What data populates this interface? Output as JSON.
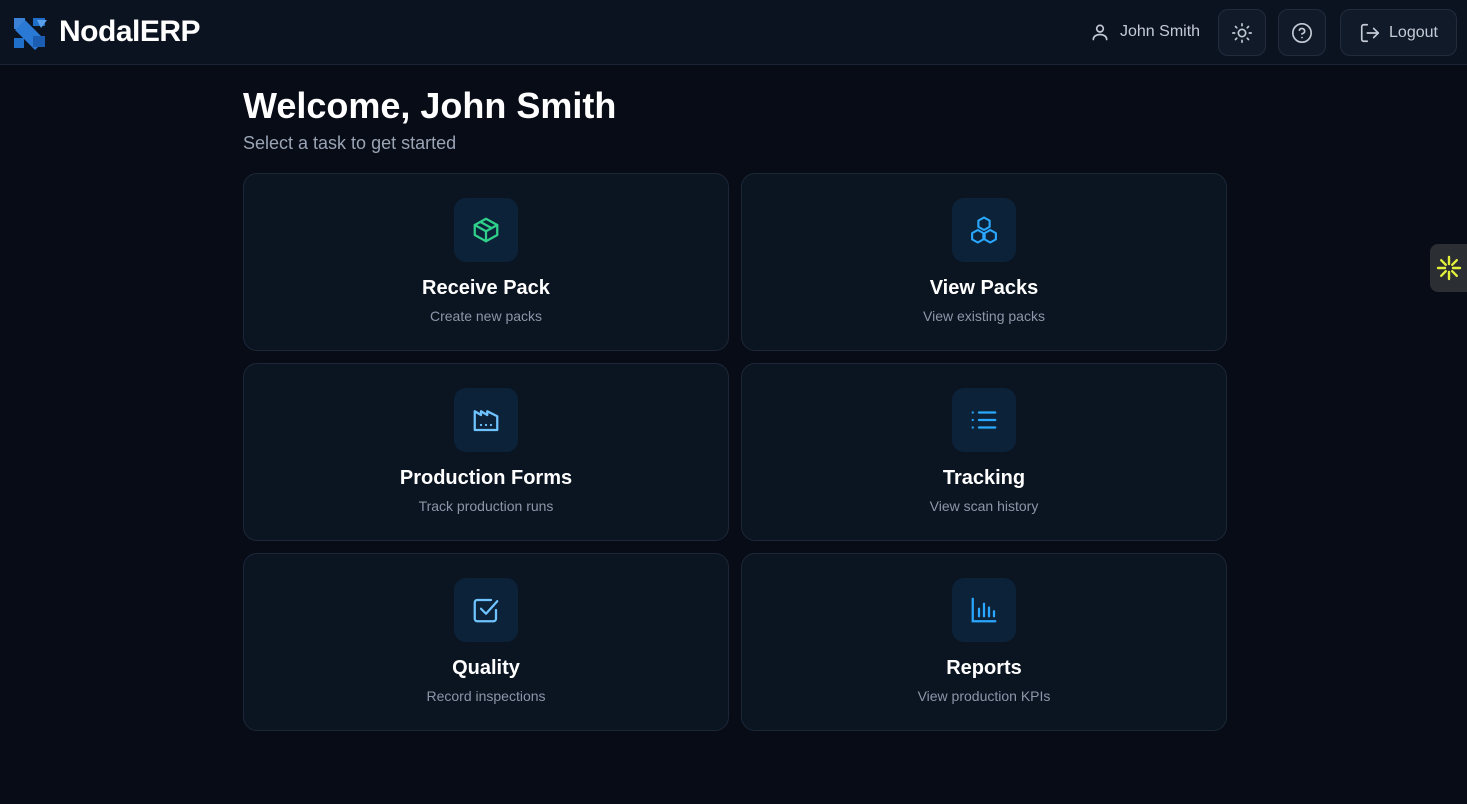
{
  "header": {
    "app_name": "NodalERP",
    "user_name": "John Smith",
    "logout_label": "Logout",
    "icons": {
      "logo": "nodal-logo",
      "user": "user-icon",
      "theme": "sun-icon",
      "help": "help-circle-icon",
      "logout": "logout-icon"
    }
  },
  "welcome": {
    "title": "Welcome, John Smith",
    "subtitle": "Select a task to get started"
  },
  "tasks": [
    {
      "title": "Receive Pack",
      "subtitle": "Create new packs",
      "icon": "box-icon",
      "icon_color": "#2fd08a"
    },
    {
      "title": "View Packs",
      "subtitle": "View existing packs",
      "icon": "boxes-icon",
      "icon_color": "#2aa8ff"
    },
    {
      "title": "Production Forms",
      "subtitle": "Track production runs",
      "icon": "factory-icon",
      "icon_color": "#6fc4ff"
    },
    {
      "title": "Tracking",
      "subtitle": "View scan history",
      "icon": "list-icon",
      "icon_color": "#2aa8ff"
    },
    {
      "title": "Quality",
      "subtitle": "Record inspections",
      "icon": "check-square-icon",
      "icon_color": "#6fc4ff"
    },
    {
      "title": "Reports",
      "subtitle": "View production KPIs",
      "icon": "bar-chart-icon",
      "icon_color": "#2aa8ff"
    }
  ],
  "colors": {
    "background": "#070c16",
    "card": "#0b1421",
    "brand_blue": "#2f7fd8",
    "side_tab_accent": "#e3f03a"
  },
  "side_tab": {
    "icon": "asterisk-icon"
  }
}
